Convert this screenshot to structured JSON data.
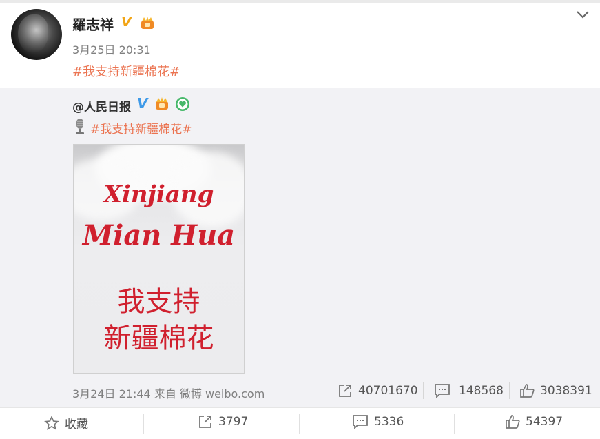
{
  "post": {
    "user_name": "羅志祥",
    "time": "3月25日 20:31",
    "text": "#我支持新疆棉花#"
  },
  "repost": {
    "user_name": "@人民日报",
    "text": "#我支持新疆棉花#",
    "image": {
      "line1": "Xinjiang",
      "line2": "Mian Hua",
      "cn_line1": "我支持",
      "cn_line2": "新疆棉花"
    },
    "footer": "3月24日 21:44 来自 微博 weibo.com",
    "shares": "40701670",
    "comments": "148568",
    "likes": "3038391"
  },
  "actions": {
    "favorite": "收藏",
    "share": "3797",
    "comment": "5336",
    "like": "54397"
  },
  "colors": {
    "accent": "#eb7350",
    "vip_gold": "#f2a516",
    "verified_blue": "#3f9ae8",
    "poster_red": "#d0202e"
  },
  "icons": [
    "chevron-down-icon",
    "verified-v-icon",
    "crown-icon",
    "heart-badge-icon",
    "microphone-icon",
    "share-icon",
    "comment-icon",
    "like-icon",
    "star-icon"
  ]
}
